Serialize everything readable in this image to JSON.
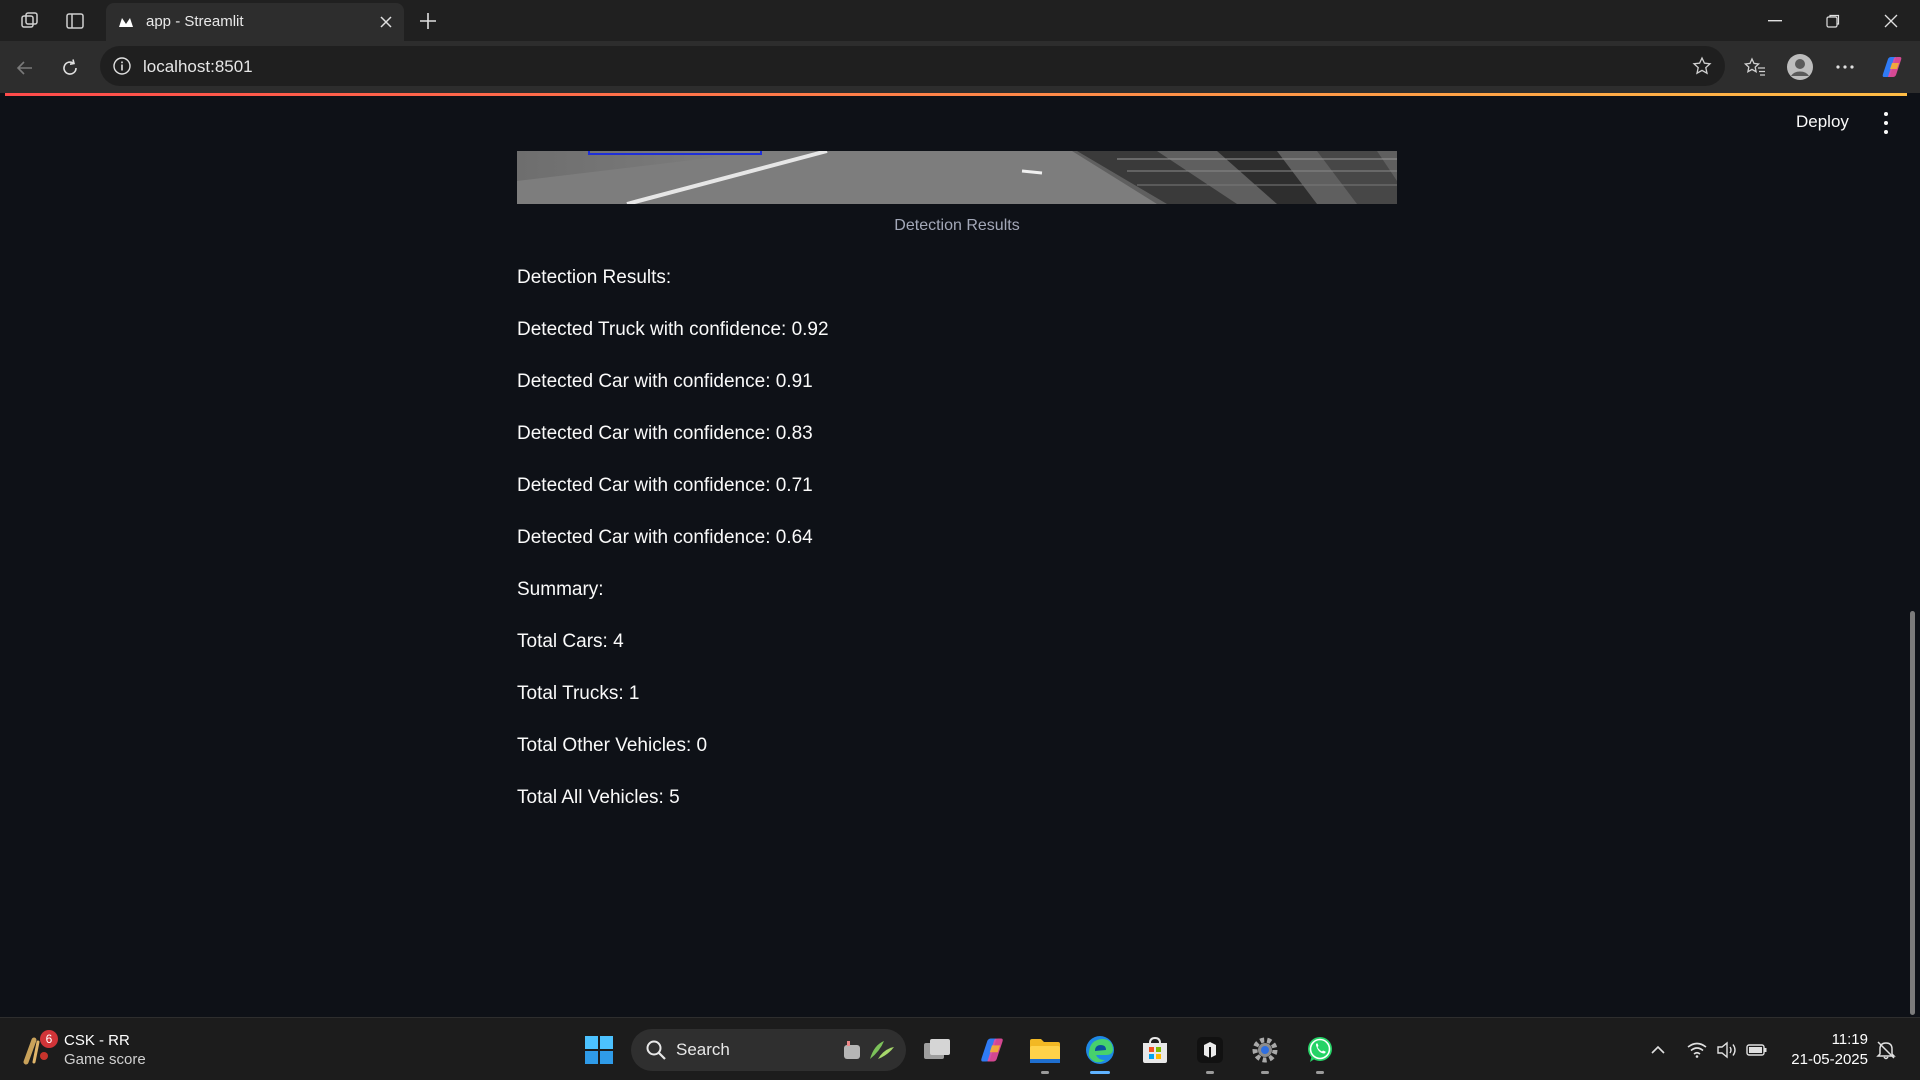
{
  "browser": {
    "tab_title": "app - Streamlit",
    "url": "localhost:8501"
  },
  "app": {
    "deploy_label": "Deploy",
    "image_caption": "Detection Results",
    "results_heading": "Detection Results:",
    "detections": [
      "Detected Truck with confidence: 0.92",
      "Detected Car with confidence: 0.91",
      "Detected Car with confidence: 0.83",
      "Detected Car with confidence: 0.71",
      "Detected Car with confidence: 0.64"
    ],
    "summary_heading": "Summary:",
    "summary": [
      "Total Cars: 4",
      "Total Trucks: 1",
      "Total Other Vehicles: 0",
      "Total All Vehicles: 5"
    ]
  },
  "taskbar": {
    "widget_badge": "6",
    "widget_title": "CSK - RR",
    "widget_subtitle": "Game score",
    "search_label": "Search",
    "time": "11:19",
    "date": "21-05-2025"
  },
  "colors": {
    "page_bg": "#0e1117",
    "text": "#fafafa",
    "caption": "#a3a8b8",
    "accent_red": "#ff4b4b",
    "accent_yellow": "#ffbd45"
  }
}
